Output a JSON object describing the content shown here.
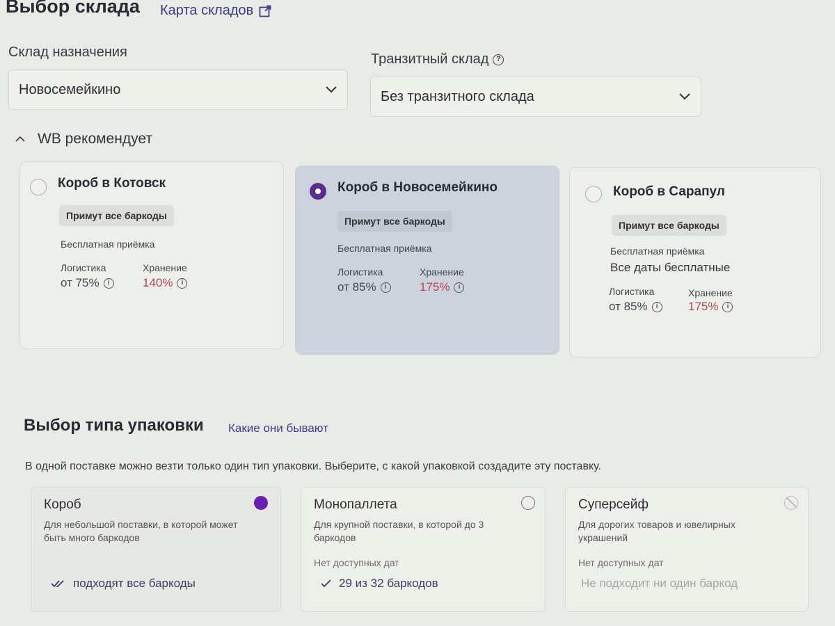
{
  "header": {
    "title": "Выбор склада",
    "map_link": "Карта складов"
  },
  "destination": {
    "label": "Склад назначения",
    "value": "Новосемейкино"
  },
  "transit": {
    "label": "Транзитный склад",
    "value": "Без транзитного склада"
  },
  "recommend": {
    "label": "WB рекомендует",
    "cards": [
      {
        "name": "Короб в Котовск",
        "badge": "Примут все баркоды",
        "free_label": "Бесплатная приёмка",
        "dates": "",
        "logistics_label": "Логистика",
        "logistics_value": "от 75%",
        "storage_label": "Хранение",
        "storage_value": "140%",
        "selected": false
      },
      {
        "name": "Короб в Новосемейкино",
        "badge": "Примут все баркоды",
        "free_label": "Бесплатная приёмка",
        "dates": "",
        "logistics_label": "Логистика",
        "logistics_value": "от 85%",
        "storage_label": "Хранение",
        "storage_value": "175%",
        "selected": true
      },
      {
        "name": "Короб в Сарапул",
        "badge": "Примут все баркоды",
        "free_label": "Бесплатная приёмка",
        "dates": "Все даты бесплатные",
        "logistics_label": "Логистика",
        "logistics_value": "от 85%",
        "storage_label": "Хранение",
        "storage_value": "175%",
        "selected": false
      }
    ]
  },
  "packaging": {
    "title": "Выбор типа упаковки",
    "link": "Какие они бывают",
    "description": "В одной поставке можно везти только один тип упаковки. Выберите, с какой упаковкой создадите эту поставку.",
    "options": [
      {
        "name": "Короб",
        "description": "Для небольшой поставки, в которой может быть много баркодов",
        "no_dates": "",
        "status": "подходят все баркоды",
        "state": "selected"
      },
      {
        "name": "Монопаллета",
        "description": "Для крупной поставки, в которой до 3 баркодов",
        "no_dates": "Нет доступных дат",
        "status": "29 из 32 баркодов",
        "state": "available"
      },
      {
        "name": "Суперсейф",
        "description": "Для дорогих товаров и ювелирных украшений",
        "no_dates": "Нет доступных дат",
        "status": "Не подходит ни один баркод",
        "state": "disabled"
      }
    ]
  },
  "colors": {
    "accent": "#5a2d8c",
    "link": "#3b3d8a",
    "storage_red": "#b8424f",
    "selected_card": "#cdd3dd"
  }
}
